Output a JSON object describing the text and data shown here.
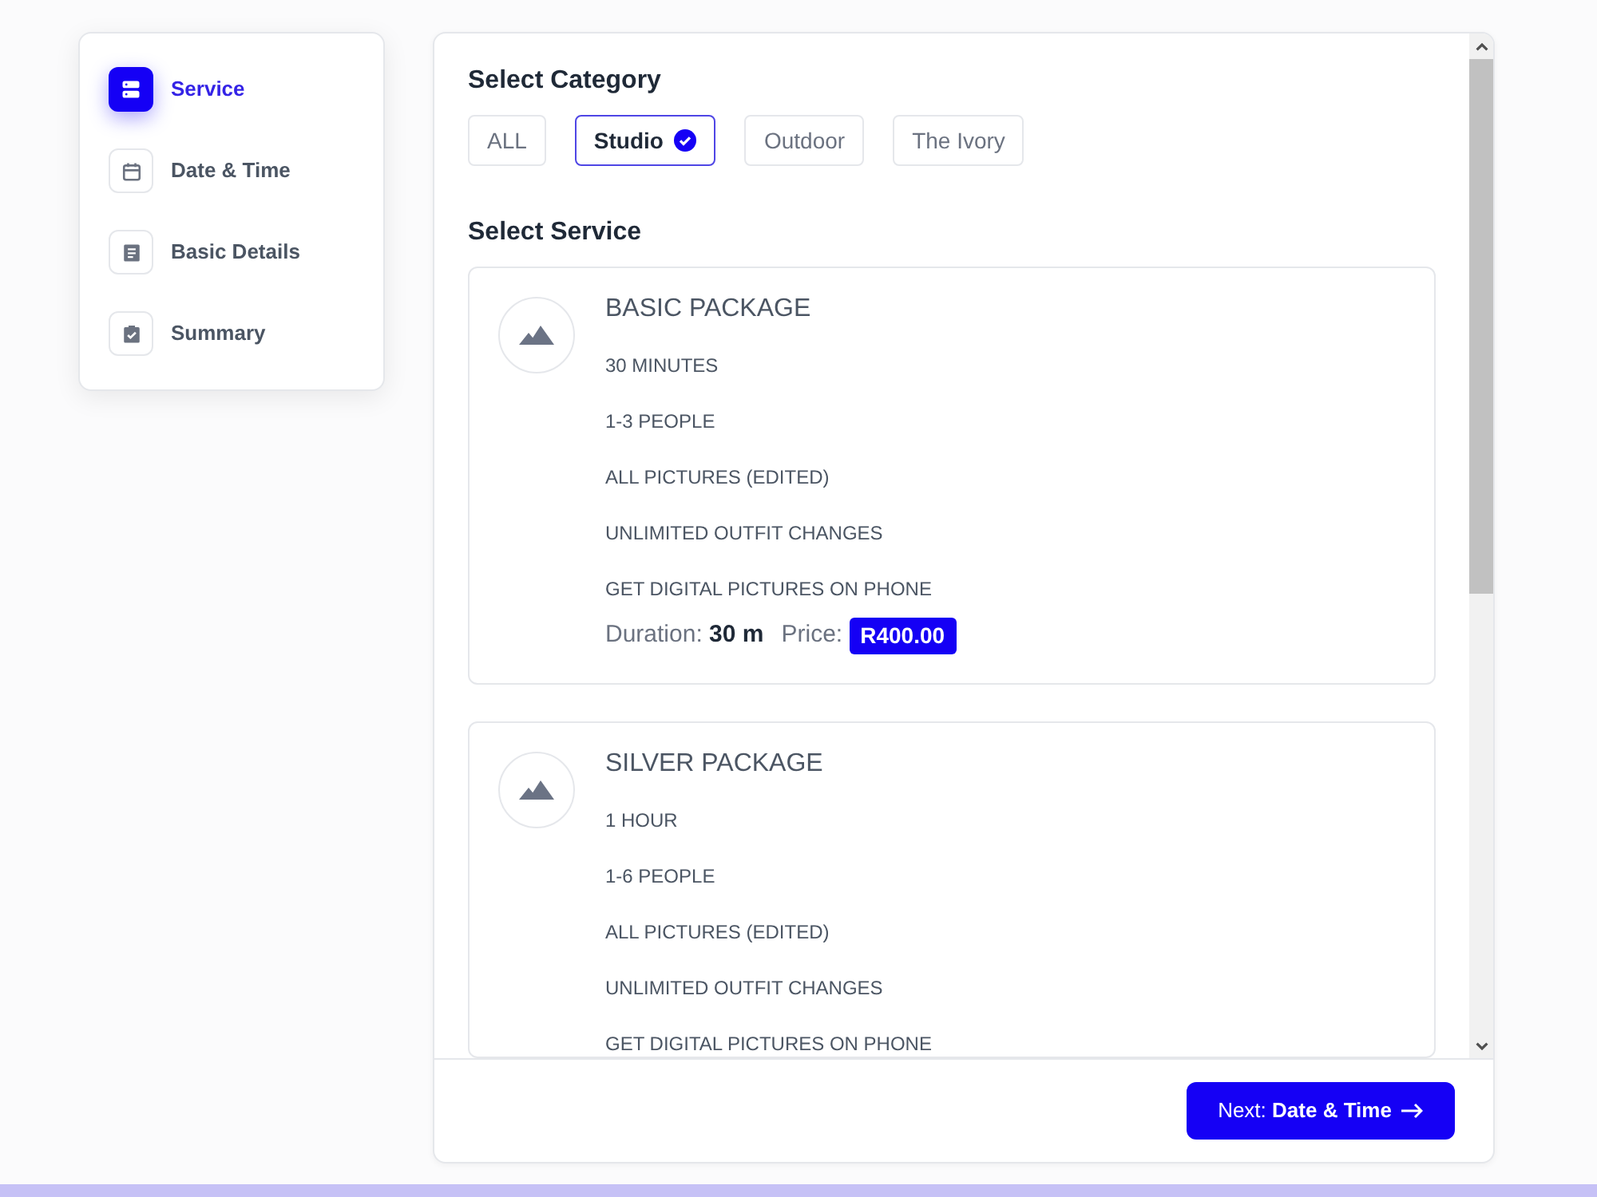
{
  "sidebar": {
    "steps": [
      {
        "label": "Service",
        "selected": true
      },
      {
        "label": "Date & Time",
        "selected": false
      },
      {
        "label": "Basic Details",
        "selected": false
      },
      {
        "label": "Summary",
        "selected": false
      }
    ]
  },
  "category": {
    "heading": "Select Category",
    "options": [
      {
        "label": "ALL",
        "selected": false
      },
      {
        "label": "Studio",
        "selected": true
      },
      {
        "label": "Outdoor",
        "selected": false
      },
      {
        "label": "The Ivory",
        "selected": false
      }
    ]
  },
  "service": {
    "heading": "Select Service",
    "packages": [
      {
        "title": "BASIC PACKAGE",
        "features": [
          "30 MINUTES",
          "1-3 PEOPLE",
          "ALL PICTURES (EDITED)",
          "UNLIMITED OUTFIT CHANGES",
          "GET DIGITAL PICTURES ON PHONE"
        ],
        "duration": "Duration: **30 m**",
        "price_label": "Price:",
        "price": "R400.00"
      },
      {
        "title": "SILVER PACKAGE",
        "features": [
          "1 HOUR",
          "1-6 PEOPLE",
          "ALL PICTURES (EDITED)",
          "UNLIMITED OUTFIT CHANGES",
          "GET DIGITAL PICTURES ON PHONE"
        ]
      }
    ]
  },
  "footer": {
    "next_button": "Next: **Date & Time**"
  }
}
